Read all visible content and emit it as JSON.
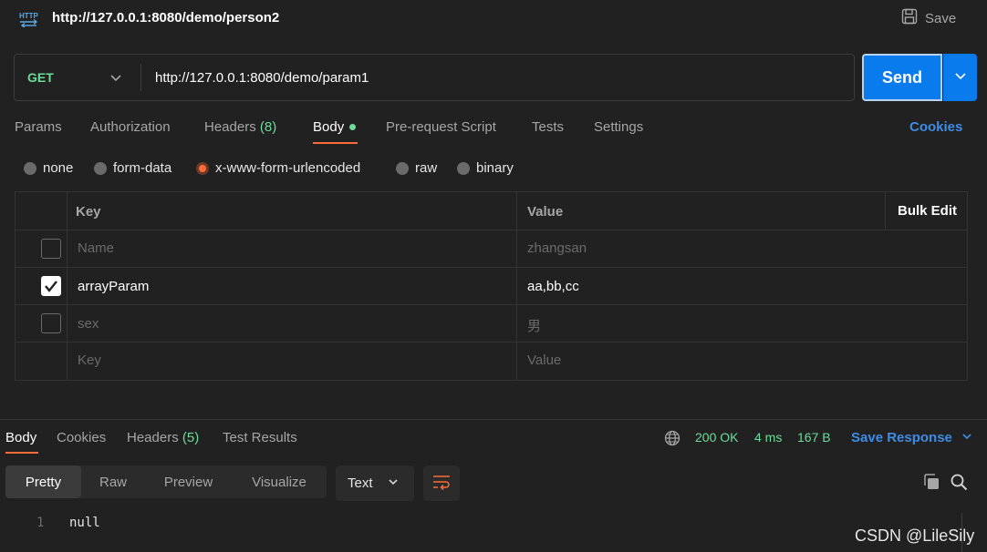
{
  "title_bar": {
    "title": "http://127.0.0.1:8080/demo/person2",
    "save_label": "Save",
    "icon": "http-icon"
  },
  "request": {
    "method": "GET",
    "url": "http://127.0.0.1:8080/demo/param1",
    "send_label": "Send"
  },
  "request_tabs": {
    "params": "Params",
    "authorization": "Authorization",
    "headers": "Headers",
    "headers_count": "(8)",
    "body": "Body",
    "pre_request": "Pre-request Script",
    "tests": "Tests",
    "settings": "Settings",
    "cookies": "Cookies",
    "active": "Body"
  },
  "body_types": {
    "none": "none",
    "form_data": "form-data",
    "urlencoded": "x-www-form-urlencoded",
    "raw": "raw",
    "binary": "binary",
    "selected": "x-www-form-urlencoded"
  },
  "params_table": {
    "header_key": "Key",
    "header_value": "Value",
    "bulk_edit": "Bulk Edit",
    "rows": [
      {
        "key": "Name",
        "value": "zhangsan",
        "checked": false
      },
      {
        "key": "arrayParam",
        "value": "aa,bb,cc",
        "checked": true
      },
      {
        "key": "sex",
        "value": "男",
        "checked": false
      },
      {
        "key": "Key",
        "value": "Value",
        "checked": false
      }
    ]
  },
  "response": {
    "tabs": {
      "body": "Body",
      "cookies": "Cookies",
      "headers": "Headers",
      "headers_count": "(5)",
      "test_results": "Test Results"
    },
    "status": "200 OK",
    "time": "4 ms",
    "size": "167 B",
    "save_response": "Save Response",
    "view_tabs": {
      "pretty": "Pretty",
      "raw": "Raw",
      "preview": "Preview",
      "visualize": "Visualize"
    },
    "format": "Text",
    "line_number": "1",
    "content": "null"
  },
  "watermark": "CSDN @LileSily",
  "colors": {
    "background": "#212121",
    "accent_orange": "#ff6c37",
    "send_blue": "#097bed",
    "link_blue": "#3d8ce8",
    "status_green": "#6bdd9a"
  }
}
